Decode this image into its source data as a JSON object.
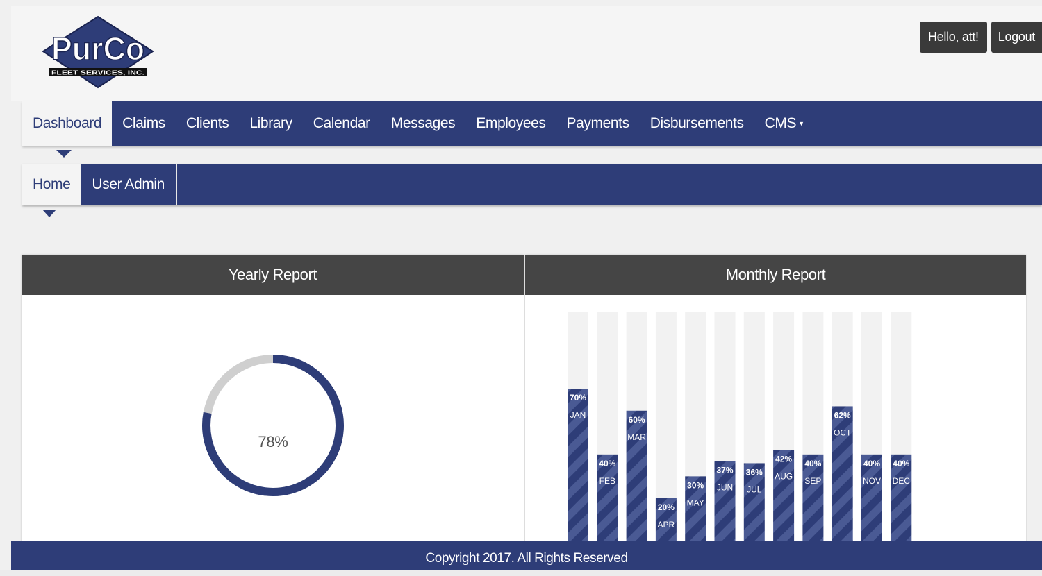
{
  "brand": {
    "logo_text": "PurCo",
    "logo_subtext": "FLEET SERVICES, INC."
  },
  "user": {
    "greeting": "Hello, att!",
    "logout_label": "Logout"
  },
  "main_nav": {
    "items": [
      {
        "label": "Dashboard",
        "active": true
      },
      {
        "label": "Claims"
      },
      {
        "label": "Clients"
      },
      {
        "label": "Library"
      },
      {
        "label": "Calendar"
      },
      {
        "label": "Messages"
      },
      {
        "label": "Employees"
      },
      {
        "label": "Payments"
      },
      {
        "label": "Disbursements"
      },
      {
        "label": "CMS"
      }
    ],
    "dropdown_icon": "caret-down-icon"
  },
  "sub_nav": {
    "items": [
      {
        "label": "Home",
        "active": true
      },
      {
        "label": "User Admin"
      }
    ]
  },
  "yearly": {
    "title": "Yearly Report",
    "value_label": "78%",
    "value": 0.78
  },
  "monthly": {
    "title": "Monthly Report"
  },
  "chart_data": {
    "type": "bar",
    "categories": [
      "JAN",
      "FEB",
      "MAR",
      "APR",
      "MAY",
      "JUN",
      "JUL",
      "AUG",
      "SEP",
      "OCT",
      "NOV",
      "DEC"
    ],
    "values": [
      70,
      40,
      60,
      20,
      30,
      37,
      36,
      42,
      40,
      62,
      40,
      40
    ],
    "value_labels": [
      "70%",
      "40%",
      "60%",
      "20%",
      "30%",
      "37%",
      "36%",
      "42%",
      "40%",
      "62%",
      "40%",
      "40%"
    ],
    "ylim": [
      0,
      100
    ]
  },
  "colors": {
    "primary": "#2e3d78",
    "header_dark": "#454545",
    "track": "#f2f2f2",
    "donut_track": "#cfcfcf"
  },
  "footer": {
    "copyright": "Copyright 2017. All Rights Reserved"
  }
}
